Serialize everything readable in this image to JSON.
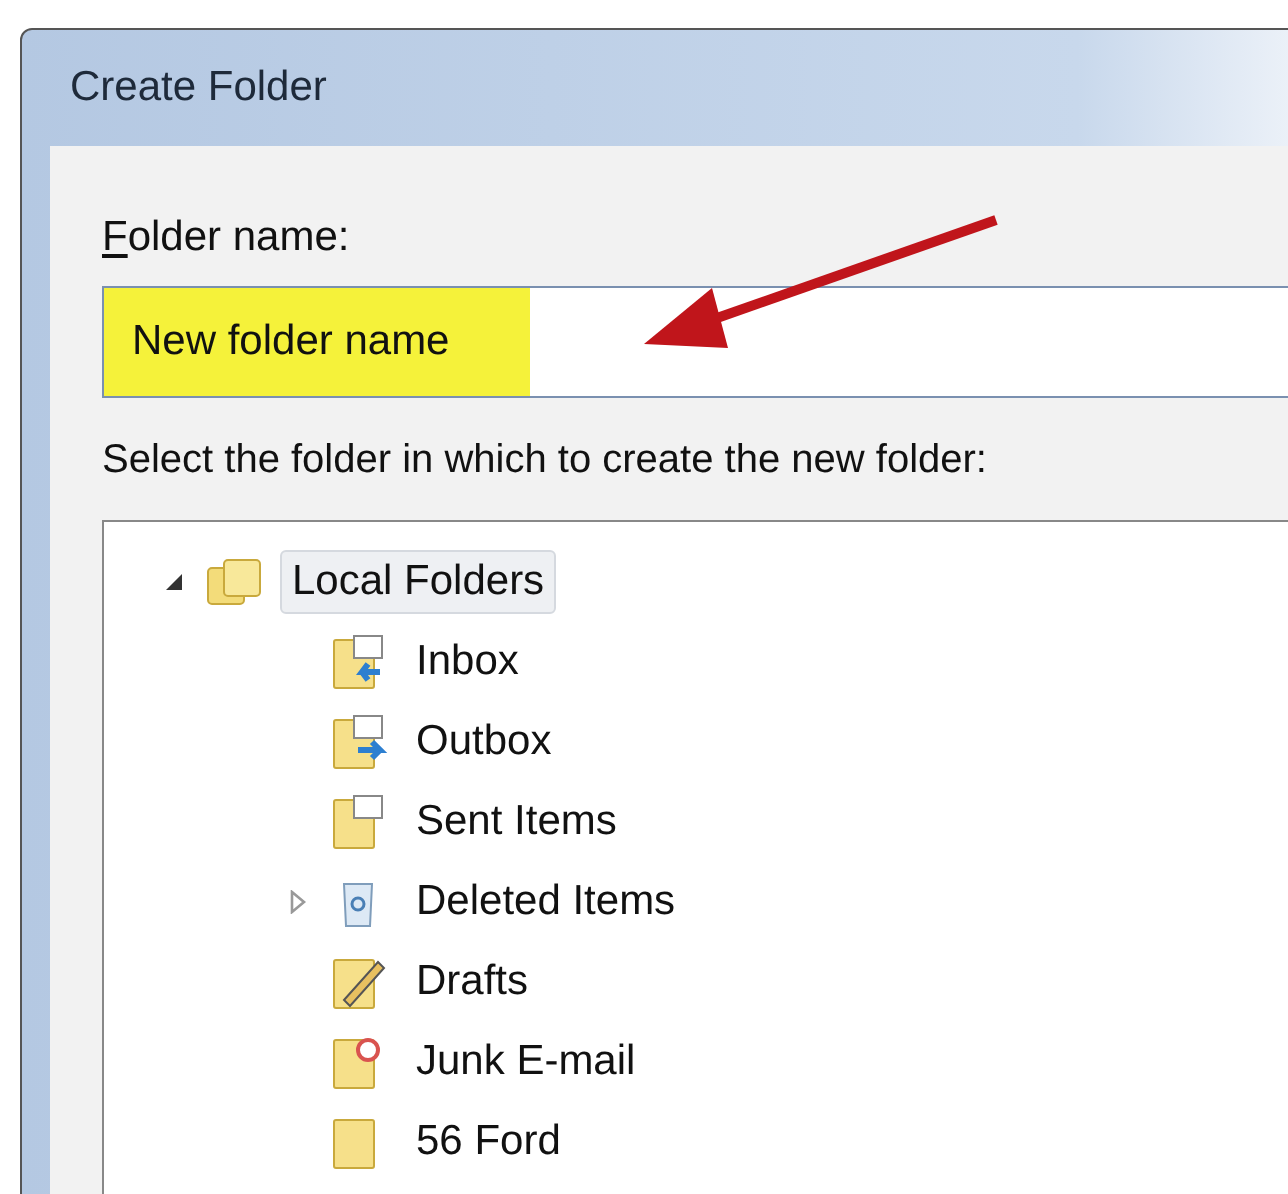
{
  "window": {
    "title": "Create Folder"
  },
  "folder_name": {
    "label": "Folder name:",
    "value": "New folder name",
    "highlighted": true
  },
  "tree_label": "Select the folder in which to create the new folder:",
  "tree": [
    {
      "label": "Local Folders",
      "kind": "folders",
      "selected": true,
      "expanded": true,
      "children": [
        {
          "label": "Inbox",
          "kind": "inbox",
          "selected": false
        },
        {
          "label": "Outbox",
          "kind": "outbox",
          "selected": false
        },
        {
          "label": "Sent Items",
          "kind": "sent",
          "selected": false
        },
        {
          "label": "Deleted Items",
          "kind": "deleted",
          "selected": false,
          "expanded": false
        },
        {
          "label": "Drafts",
          "kind": "drafts",
          "selected": false
        },
        {
          "label": "Junk E-mail",
          "kind": "junk",
          "selected": false
        },
        {
          "label": "56 Ford",
          "kind": "folder",
          "selected": false
        }
      ]
    }
  ]
}
